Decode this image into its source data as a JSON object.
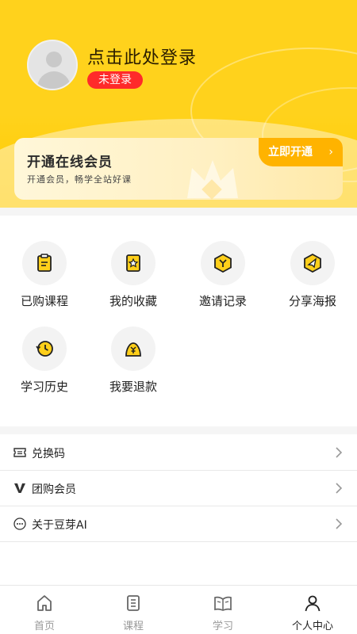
{
  "profile": {
    "login_prompt": "点击此处登录",
    "status_badge": "未登录"
  },
  "vip": {
    "title": "开通在线会员",
    "subtitle": "开通会员，畅学全站好课",
    "button_label": "立即开通",
    "chevron": "›"
  },
  "grid": [
    {
      "label": "已购课程",
      "icon": "clipboard-icon"
    },
    {
      "label": "我的收藏",
      "icon": "bookmark-star-icon"
    },
    {
      "label": "邀请记录",
      "icon": "hexagon-y-icon"
    },
    {
      "label": "分享海报",
      "icon": "hexagon-send-icon"
    },
    {
      "label": "学习历史",
      "icon": "history-clock-icon"
    },
    {
      "label": "我要退款",
      "icon": "refund-bag-icon"
    }
  ],
  "list": [
    {
      "label": "兑换码",
      "icon": "ticket-icon"
    },
    {
      "label": "团购会员",
      "icon": "v-icon"
    },
    {
      "label": "关于豆芽AI",
      "icon": "more-dots-icon"
    }
  ],
  "tabs": [
    {
      "label": "首页",
      "icon": "home-icon",
      "active": false
    },
    {
      "label": "课程",
      "icon": "course-list-icon",
      "active": false
    },
    {
      "label": "学习",
      "icon": "open-book-icon",
      "active": false
    },
    {
      "label": "个人中心",
      "icon": "person-icon",
      "active": true
    }
  ],
  "colors": {
    "accent": "#ffd21c",
    "badge": "#ff2a2a",
    "vip_button": "#ffb300"
  }
}
